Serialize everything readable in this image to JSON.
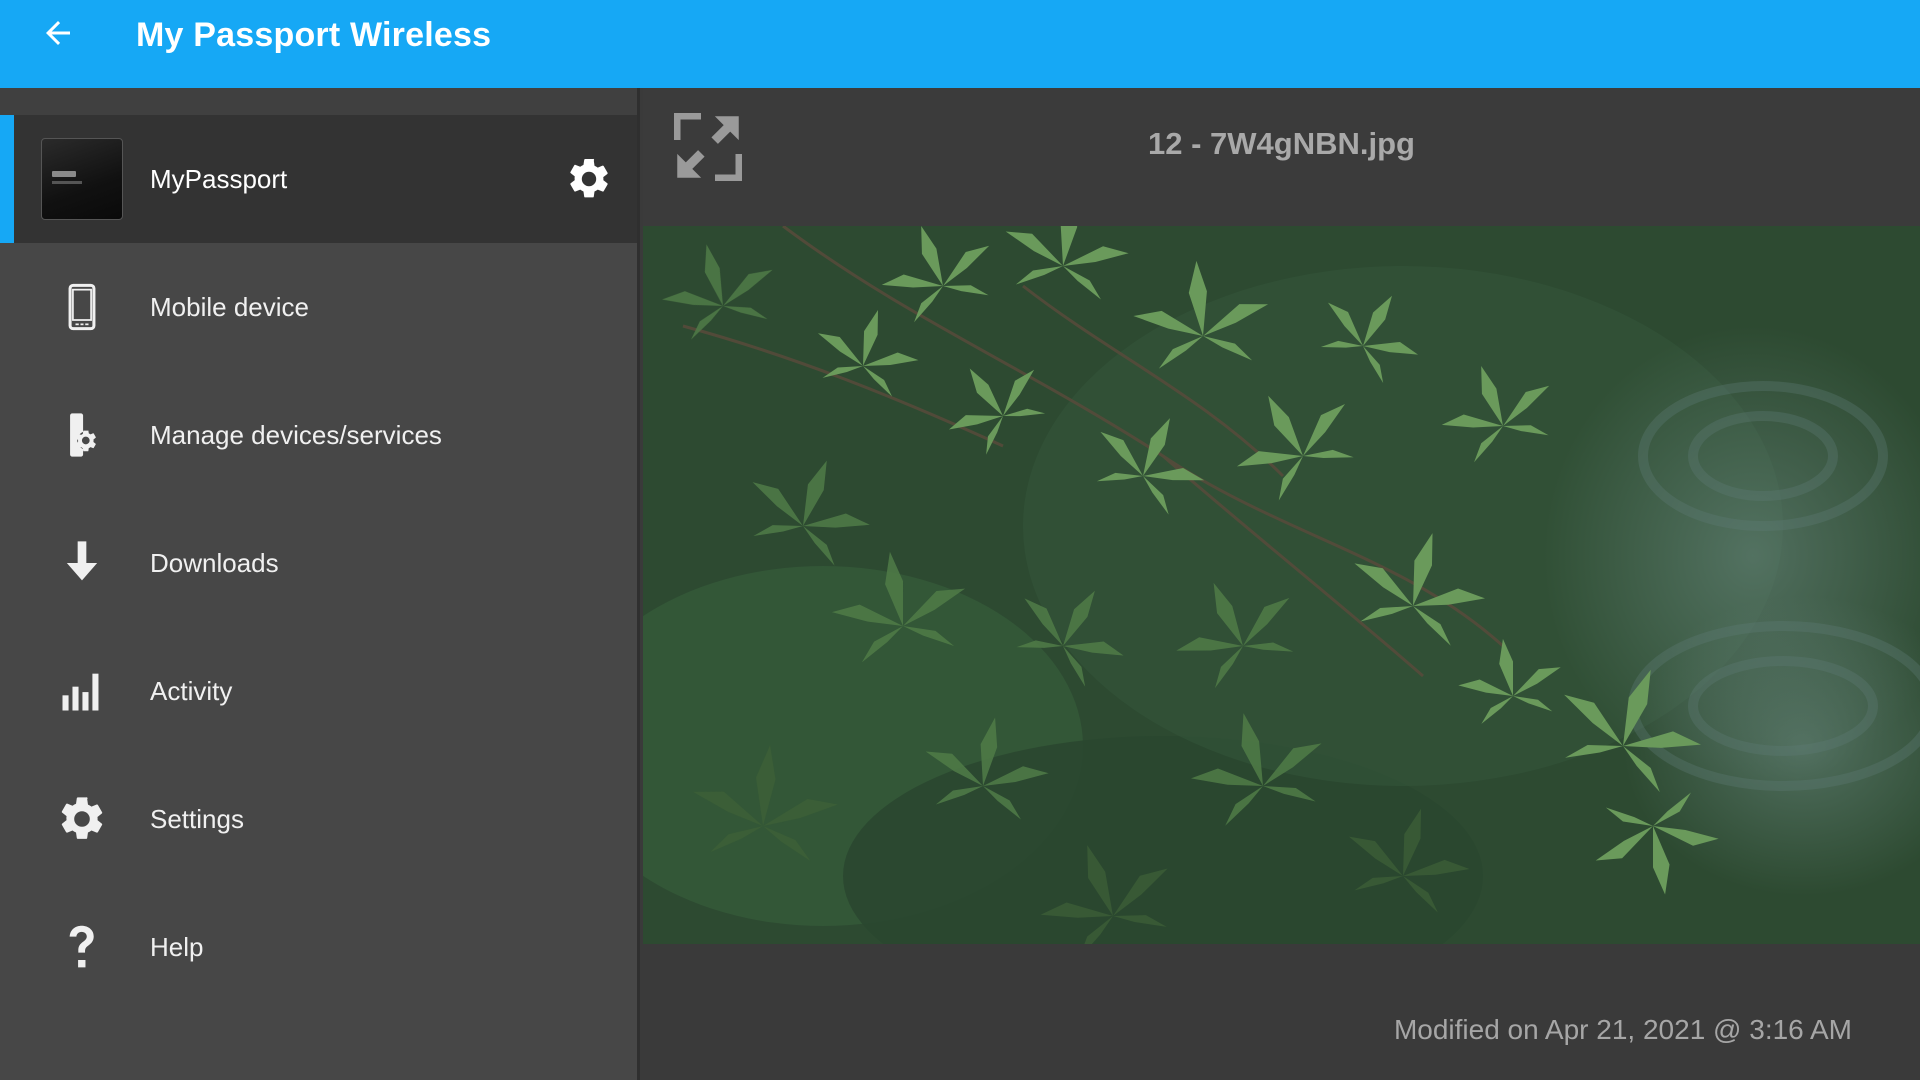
{
  "appbar": {
    "title": "My Passport Wireless"
  },
  "sidebar": {
    "device": {
      "name": "MyPassport"
    },
    "items": [
      {
        "label": "Mobile device",
        "icon": "phone-icon"
      },
      {
        "label": "Manage devices/services",
        "icon": "device-settings-icon"
      },
      {
        "label": "Downloads",
        "icon": "download-arrow-icon"
      },
      {
        "label": "Activity",
        "icon": "bar-chart-icon"
      },
      {
        "label": "Settings",
        "icon": "gear-icon"
      },
      {
        "label": "Help",
        "icon": "question-mark-icon"
      }
    ]
  },
  "viewer": {
    "file_title": "12 - 7W4gNBN.jpg",
    "modified": "Modified on Apr 21, 2021 @ 3:16 AM"
  },
  "colors": {
    "accent": "#16a8f5",
    "sidebar_bg": "#474747",
    "selected_row_bg": "#333333",
    "viewer_bg": "#3a3a3a"
  }
}
